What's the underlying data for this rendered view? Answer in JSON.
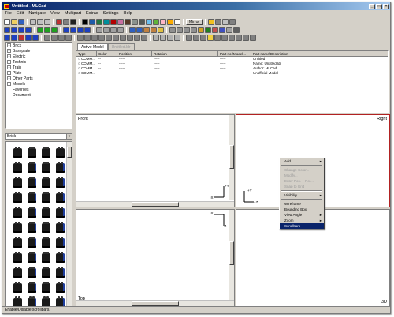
{
  "window": {
    "title": "Untitled - MLCad"
  },
  "menu": [
    "File",
    "Edit",
    "Navigate",
    "View",
    "Multipart",
    "Extras",
    "Settings",
    "Help"
  ],
  "toolbar": {
    "mirror_label": "Mirror"
  },
  "tree": {
    "items": [
      {
        "label": "Brick",
        "expandable": true
      },
      {
        "label": "Baseplate",
        "expandable": true
      },
      {
        "label": "Electric",
        "expandable": true
      },
      {
        "label": "Technic",
        "expandable": true
      },
      {
        "label": "Train",
        "expandable": true
      },
      {
        "label": "Plate",
        "expandable": true
      },
      {
        "label": "Other Parts",
        "expandable": true
      },
      {
        "label": "Models",
        "expandable": true
      },
      {
        "label": "Favorites",
        "expandable": false
      },
      {
        "label": "Document",
        "expandable": false
      }
    ]
  },
  "category_select": {
    "value": "Brick"
  },
  "tabs": [
    {
      "label": "Active Model",
      "active": true
    },
    {
      "label": "Untitled.ldr",
      "active": false
    }
  ],
  "table": {
    "columns": [
      "Type",
      "Color",
      "Position",
      "Rotation",
      "Part no./Model...",
      "Part name/Description"
    ],
    "rows": [
      [
        "COMM...",
        "--",
        "-----",
        "-----",
        "-----",
        "Untitled"
      ],
      [
        "COMM...",
        "--",
        "-----",
        "-----",
        "-----",
        "Name: Untitled.ldr"
      ],
      [
        "COMM...",
        "--",
        "-----",
        "-----",
        "-----",
        "Author: MLCad"
      ],
      [
        "COMM...",
        "--",
        "-----",
        "-----",
        "-----",
        "Unofficial Model"
      ]
    ]
  },
  "viewports": {
    "front": "Front",
    "right": "Right",
    "top": "Top",
    "three_d": "3D"
  },
  "axes": {
    "plus_y": "+Y",
    "minus_x": "-X",
    "plus_z": "+Z",
    "minus_z": "-Z"
  },
  "context_menu": {
    "items": [
      {
        "label": "Add",
        "submenu": true,
        "disabled": false,
        "selected": false
      },
      {
        "sep": true
      },
      {
        "label": "Change Color...",
        "submenu": false,
        "disabled": true,
        "selected": false
      },
      {
        "label": "Modify...",
        "submenu": false,
        "disabled": true,
        "selected": false
      },
      {
        "label": "Enter Pos. + Rot...",
        "submenu": false,
        "disabled": true,
        "selected": false
      },
      {
        "label": "Snap to Grid",
        "submenu": false,
        "disabled": true,
        "selected": false
      },
      {
        "sep": true
      },
      {
        "label": "Visibility",
        "submenu": true,
        "disabled": false,
        "selected": false
      },
      {
        "sep": true
      },
      {
        "label": "Wireframe",
        "submenu": false,
        "disabled": false,
        "selected": false
      },
      {
        "label": "Bounding Box",
        "submenu": false,
        "disabled": false,
        "selected": false
      },
      {
        "label": "View Angle",
        "submenu": true,
        "disabled": false,
        "selected": false
      },
      {
        "label": "Zoom",
        "submenu": true,
        "disabled": false,
        "selected": false
      },
      {
        "label": "Scrollbars",
        "submenu": false,
        "disabled": false,
        "selected": true
      }
    ]
  },
  "status": {
    "text": "Enable/Disable scrollbars."
  },
  "colors": {
    "title_active": "#0a246a",
    "selection": "#0a246a",
    "active_view_border": "#b22222"
  }
}
